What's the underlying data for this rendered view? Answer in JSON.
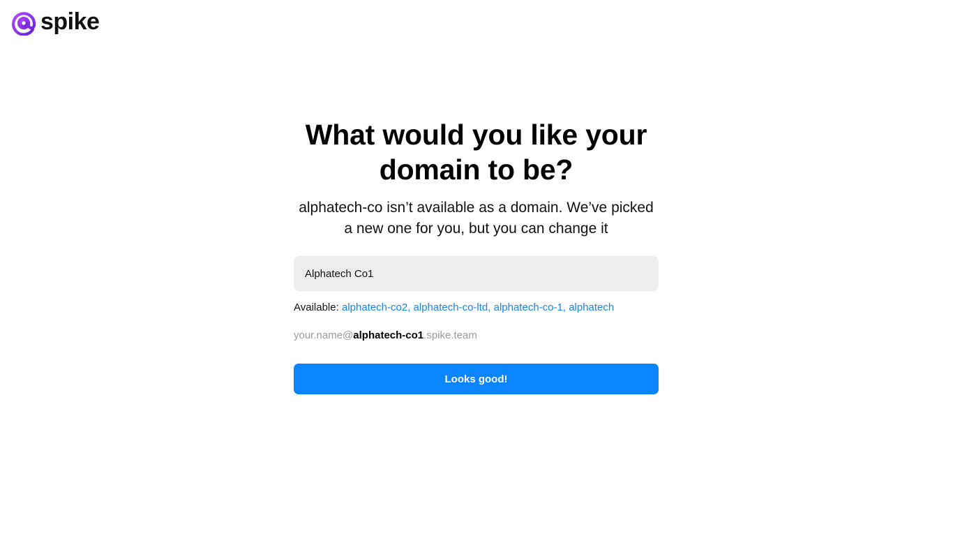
{
  "brand": {
    "logo_icon": "spike-at-logo-icon",
    "name": "spike",
    "colors": {
      "purple": "#8a2be2",
      "violet": "#6a1fd6"
    }
  },
  "main": {
    "title": "What would you like your domain to be?",
    "subtitle": "alphatech-co isn’t available as a domain. We’ve picked a new one for you, but you can change it",
    "domain_input": {
      "value": "Alphatech Co1"
    },
    "available": {
      "label": "Available:",
      "suggestions": [
        "alphatech-co2",
        "alphatech-co-ltd",
        "alphatech-co-1",
        "alphatech"
      ],
      "separator": ", "
    },
    "preview": {
      "prefix": "your.name@",
      "domain": "alphatech-co1",
      "suffix": ".spike.team"
    },
    "submit_label": "Looks good!"
  },
  "colors": {
    "accent": "#0a84ff",
    "link": "#1a83e8",
    "input_bg": "#ededed",
    "muted_text": "#9a9a9a"
  }
}
